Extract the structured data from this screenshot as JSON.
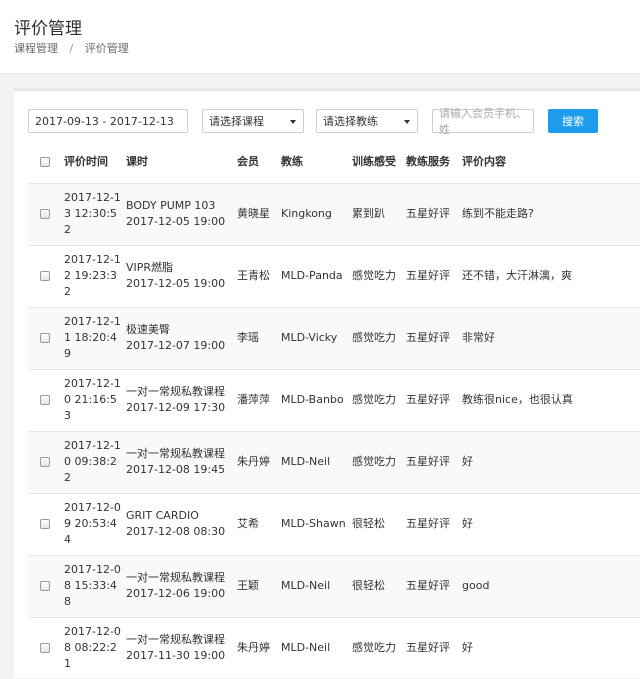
{
  "header": {
    "title": "评价管理",
    "breadcrumb": [
      "课程管理",
      "/",
      "评价管理"
    ]
  },
  "filters": {
    "date_range": "2017-09-13 - 2017-12-13",
    "course_select": "请选择课程",
    "coach_select": "请选择教练",
    "member_placeholder": "请输入会员手机、姓",
    "search_label": "搜索"
  },
  "table": {
    "columns": [
      "评价时间",
      "课时",
      "会员",
      "教练",
      "训练感受",
      "教练服务",
      "评价内容"
    ],
    "rows": [
      {
        "time": "2017-12-13 12:30:52",
        "lesson": "BODY PUMP 103",
        "lesson_time": "2017-12-05 19:00",
        "member": "黄晓星",
        "coach": "Kingkong",
        "feel": "累到趴",
        "service": "五星好评",
        "content": "练到不能走路?"
      },
      {
        "time": "2017-12-12 19:23:32",
        "lesson": "VIPR燃脂",
        "lesson_time": "2017-12-05 19:00",
        "member": "王青松",
        "coach": "MLD-Panda",
        "feel": "感觉吃力",
        "service": "五星好评",
        "content": "还不错，大汗淋漓，爽"
      },
      {
        "time": "2017-12-11 18:20:49",
        "lesson": "极速美臀",
        "lesson_time": "2017-12-07 19:00",
        "member": "李瑶",
        "coach": "MLD-Vicky",
        "feel": "感觉吃力",
        "service": "五星好评",
        "content": "非常好"
      },
      {
        "time": "2017-12-10 21:16:53",
        "lesson": "一对一常规私教课程",
        "lesson_time": "2017-12-09 17:30",
        "member": "潘萍萍",
        "coach": "MLD-Banbo",
        "feel": "感觉吃力",
        "service": "五星好评",
        "content": "教练很nice，也很认真"
      },
      {
        "time": "2017-12-10 09:38:22",
        "lesson": "一对一常规私教课程",
        "lesson_time": "2017-12-08 19:45",
        "member": "朱丹婷",
        "coach": "MLD-Neil",
        "feel": "感觉吃力",
        "service": "五星好评",
        "content": "好"
      },
      {
        "time": "2017-12-09 20:53:44",
        "lesson": "GRIT CARDIO",
        "lesson_time": "2017-12-08 08:30",
        "member": "艾希",
        "coach": "MLD-Shawn",
        "feel": "很轻松",
        "service": "五星好评",
        "content": "好"
      },
      {
        "time": "2017-12-08 15:33:48",
        "lesson": "一对一常规私教课程",
        "lesson_time": "2017-12-06 19:00",
        "member": "王颖",
        "coach": "MLD-Neil",
        "feel": "很轻松",
        "service": "五星好评",
        "content": "good"
      },
      {
        "time": "2017-12-08 08:22:21",
        "lesson": "一对一常规私教课程",
        "lesson_time": "2017-11-30 19:00",
        "member": "朱丹婷",
        "coach": "MLD-Neil",
        "feel": "感觉吃力",
        "service": "五星好评",
        "content": "好"
      }
    ]
  },
  "colors": {
    "primary": "#1c9cec",
    "border": "#e7eaec",
    "stripe": "#f9f9f9"
  }
}
